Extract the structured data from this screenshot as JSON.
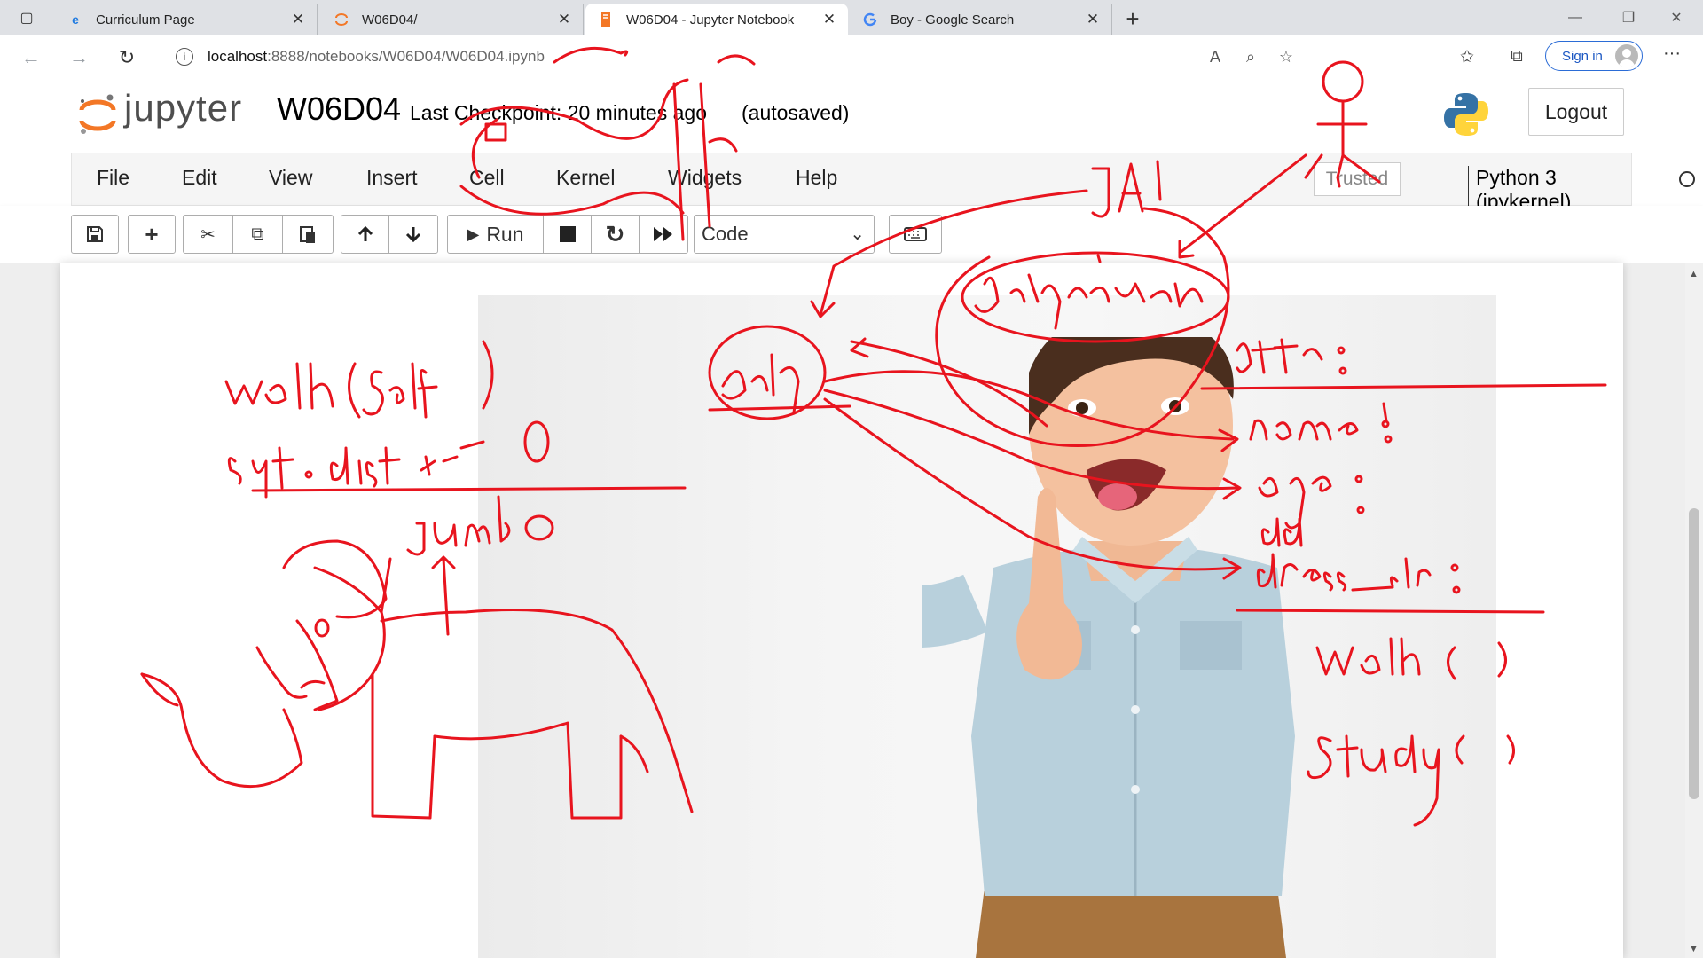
{
  "browser": {
    "tabs": [
      {
        "title": "Curriculum Page",
        "icon": "edge-icon"
      },
      {
        "title": "W06D04/",
        "icon": "jupyter-icon"
      },
      {
        "title": "W06D04 - Jupyter Notebook",
        "icon": "notebook-icon",
        "active": true
      },
      {
        "title": "Boy - Google Search",
        "icon": "google-icon"
      }
    ],
    "close_glyph": "✕",
    "new_tab_glyph": "+",
    "url_host": "localhost",
    "url_path": ":8888/notebooks/W06D04/W06D04.ipynb",
    "signin_label": "Sign in"
  },
  "jupyter": {
    "wordmark": "jupyter",
    "notebook_name": "W06D04",
    "checkpoint": "Last Checkpoint: 20 minutes ago",
    "autosaved": "(autosaved)",
    "logout_label": "Logout",
    "menu": [
      "File",
      "Edit",
      "View",
      "Insert",
      "Cell",
      "Kernel",
      "Widgets",
      "Help"
    ],
    "trusted_label": "Trusted",
    "kernel_name": "Python 3 (ipykernel)",
    "run_label": "Run",
    "cell_type": "Code"
  },
  "colors": {
    "ink": "#e8141e",
    "jupyter_orange": "#f37726",
    "python_blue": "#3572a5",
    "python_yellow": "#ffd43b"
  }
}
